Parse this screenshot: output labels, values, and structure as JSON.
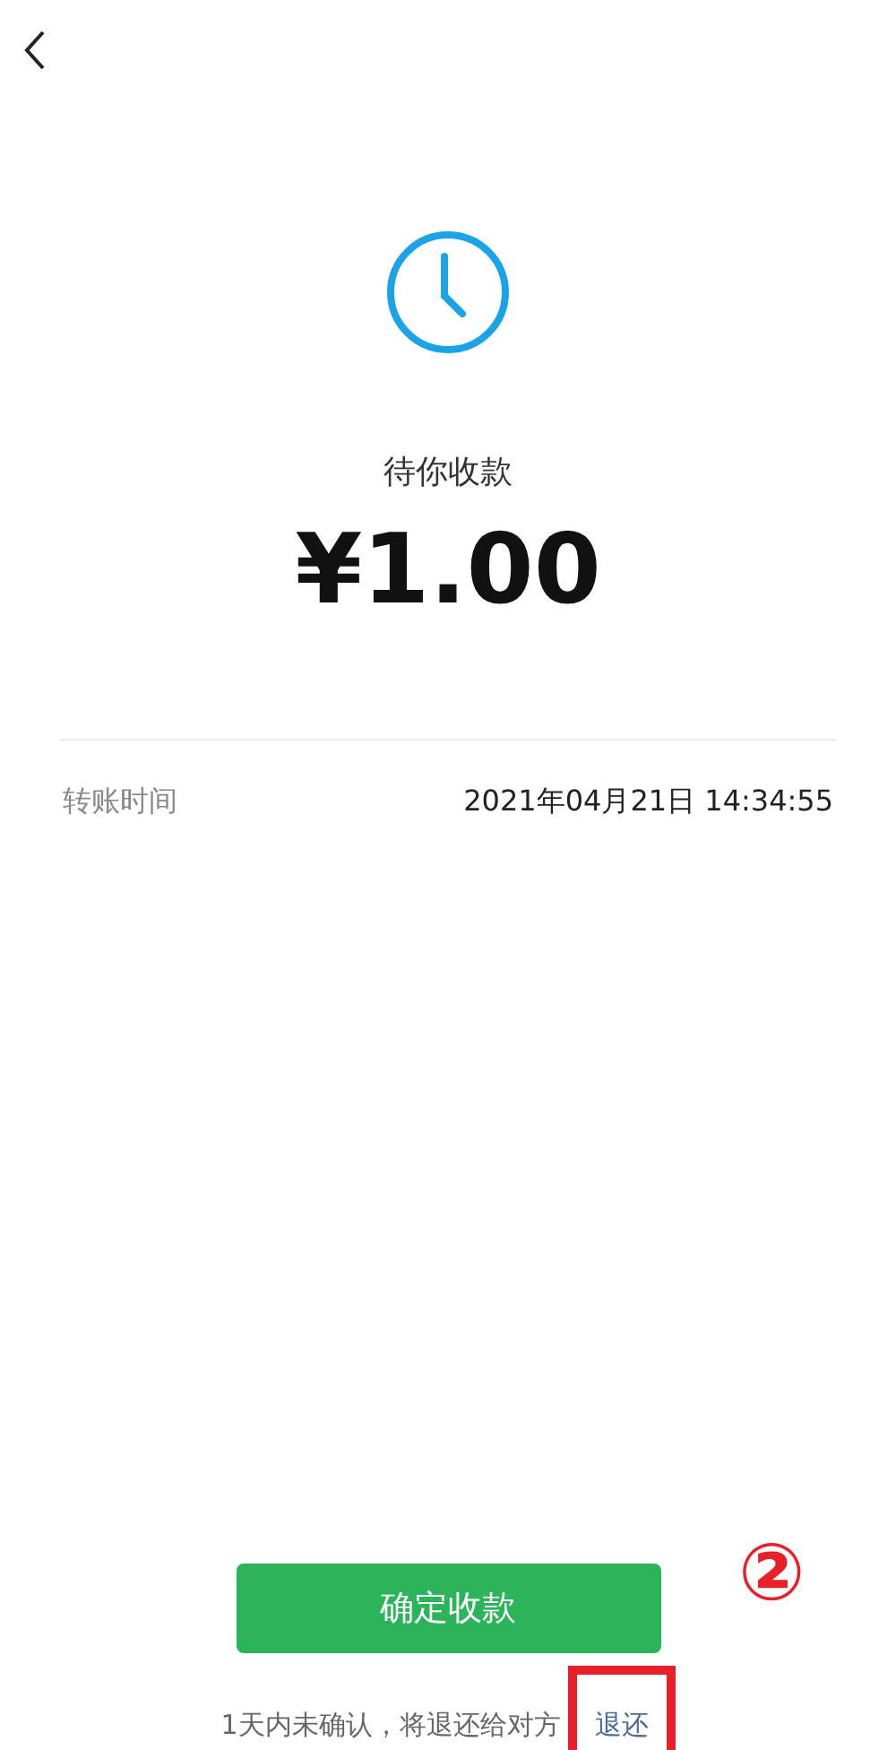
{
  "status": {
    "title": "待你收款",
    "amount": "¥1.00"
  },
  "details": [
    {
      "label": "转账时间",
      "value": "2021年04月21日 14:34:55"
    }
  ],
  "confirm_button": {
    "label": "确定收款"
  },
  "footer": {
    "note": "1天内未确认，将退还给对方",
    "link": "退还"
  },
  "annotation": {
    "marker": "②"
  }
}
